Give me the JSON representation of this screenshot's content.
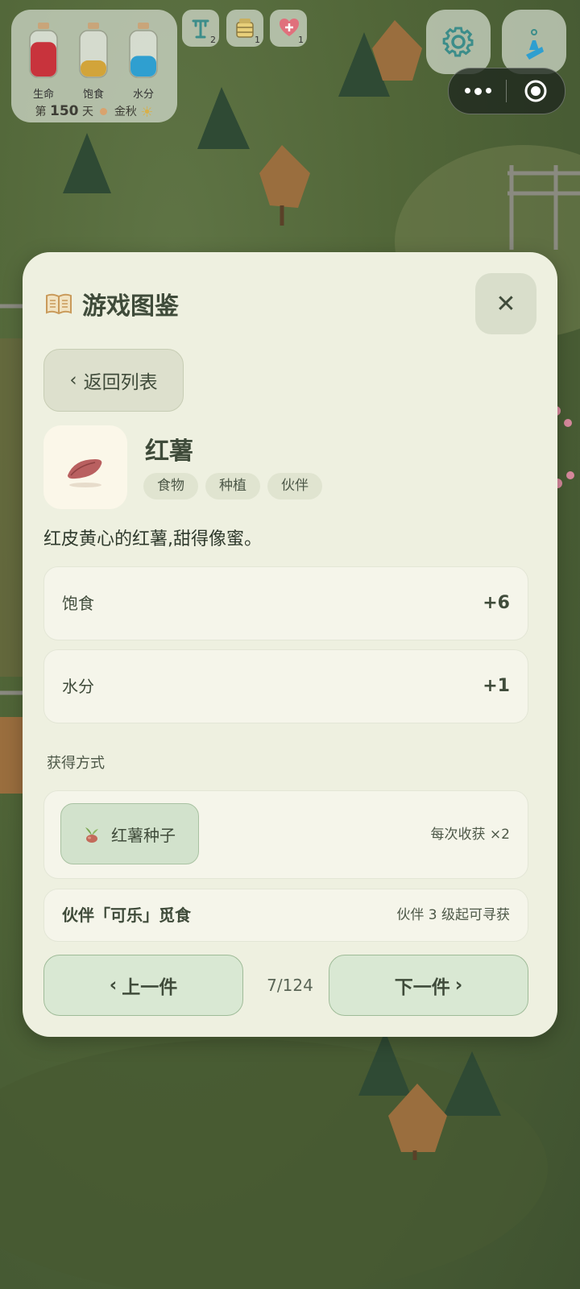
{
  "hud": {
    "stats": [
      {
        "label": "生命",
        "color": "#c8333c",
        "level": 0.75
      },
      {
        "label": "饱食",
        "color": "#d2a43a",
        "level": 0.35
      },
      {
        "label": "水分",
        "color": "#2f9fd0",
        "level": 0.45
      }
    ],
    "day_prefix": "第",
    "day_number": "150",
    "day_suffix": "天",
    "season": "金秋",
    "badges": [
      {
        "icon": "totem-icon",
        "count": "2"
      },
      {
        "icon": "beehive-icon",
        "count": "1"
      },
      {
        "icon": "heart-plus-icon",
        "count": "1"
      }
    ]
  },
  "modal": {
    "title": "游戏图鉴",
    "back_label": "返回列表",
    "item": {
      "name": "红薯",
      "tags": [
        "食物",
        "种植",
        "伙伴"
      ],
      "description": "红皮黄心的红薯,甜得像蜜。",
      "stats": [
        {
          "label": "饱食",
          "value": "+6"
        },
        {
          "label": "水分",
          "value": "+1"
        }
      ]
    },
    "obtain": {
      "section_label": "获得方式",
      "seed_label": "红薯种子",
      "harvest_note": "每次收获 ×2",
      "companion_label": "伙伴「可乐」觅食",
      "companion_note": "伙伴 3 级起可寻获"
    },
    "nav": {
      "prev_label": "上一件",
      "next_label": "下一件",
      "page": "7/124"
    }
  }
}
